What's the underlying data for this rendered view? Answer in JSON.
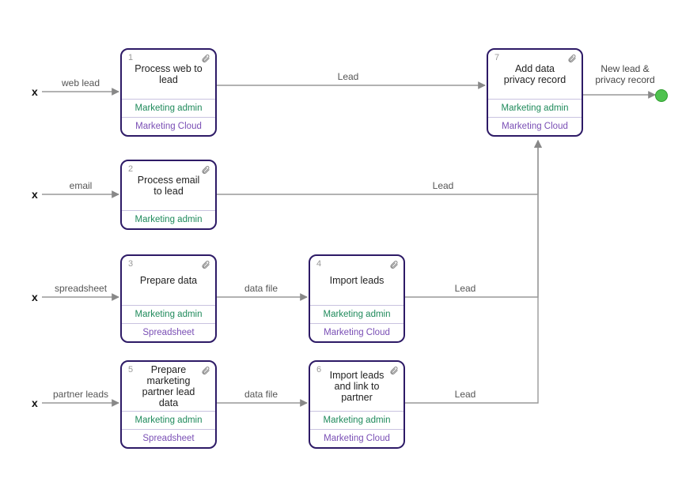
{
  "chart_data": {
    "type": "flow",
    "start_markers": [
      "x",
      "x",
      "x",
      "x"
    ],
    "nodes": [
      {
        "id": 1,
        "title": "Process web to lead",
        "role": "Marketing admin",
        "system": "Marketing Cloud"
      },
      {
        "id": 2,
        "title": "Process email to lead",
        "role": "Marketing admin"
      },
      {
        "id": 3,
        "title": "Prepare data",
        "role": "Marketing admin",
        "system": "Spreadsheet"
      },
      {
        "id": 4,
        "title": "Import leads",
        "role": "Marketing admin",
        "system": "Marketing Cloud"
      },
      {
        "id": 5,
        "title": "Prepare marketing partner lead data",
        "role": "Marketing admin",
        "system": "Spreadsheet"
      },
      {
        "id": 6,
        "title": "Import leads and link to partner",
        "role": "Marketing admin",
        "system": "Marketing Cloud"
      },
      {
        "id": 7,
        "title": "Add data privacy record",
        "role": "Marketing admin",
        "system": "Marketing Cloud"
      }
    ],
    "edges": [
      {
        "from": "start",
        "to": 1,
        "label": "web lead"
      },
      {
        "from": "start",
        "to": 2,
        "label": "email"
      },
      {
        "from": "start",
        "to": 3,
        "label": "spreadsheet"
      },
      {
        "from": "start",
        "to": 5,
        "label": "partner leads"
      },
      {
        "from": 1,
        "to": 7,
        "label": "Lead"
      },
      {
        "from": 2,
        "to": 7,
        "label": "Lead"
      },
      {
        "from": 3,
        "to": 4,
        "label": "data file"
      },
      {
        "from": 4,
        "to": 7,
        "label": "Lead"
      },
      {
        "from": 5,
        "to": 6,
        "label": "data file"
      },
      {
        "from": 6,
        "to": 7,
        "label": "Lead"
      },
      {
        "from": 7,
        "to": "end",
        "label": "New lead & privacy record"
      }
    ],
    "end_label": "New lead & privacy record"
  },
  "nodes": {
    "n1": {
      "num": "1",
      "title": "Process web to lead",
      "role": "Marketing admin",
      "sys": "Marketing Cloud"
    },
    "n2": {
      "num": "2",
      "title": "Process email to lead",
      "role": "Marketing admin"
    },
    "n3": {
      "num": "3",
      "title": "Prepare data",
      "role": "Marketing admin",
      "sys": "Spreadsheet"
    },
    "n4": {
      "num": "4",
      "title": "Import leads",
      "role": "Marketing admin",
      "sys": "Marketing Cloud"
    },
    "n5": {
      "num": "5",
      "title": "Prepare marketing partner lead data",
      "role": "Marketing admin",
      "sys": "Spreadsheet"
    },
    "n6": {
      "num": "6",
      "title": "Import leads and link to partner",
      "role": "Marketing admin",
      "sys": "Marketing Cloud"
    },
    "n7": {
      "num": "7",
      "title": "Add data privacy record",
      "role": "Marketing admin",
      "sys": "Marketing Cloud"
    }
  },
  "labels": {
    "e_web": "web lead",
    "e_email": "email",
    "e_spread": "spreadsheet",
    "e_partner": "partner leads",
    "e_lead": "Lead",
    "e_datafile": "data file",
    "end": "New lead & privacy record"
  },
  "x": "x"
}
